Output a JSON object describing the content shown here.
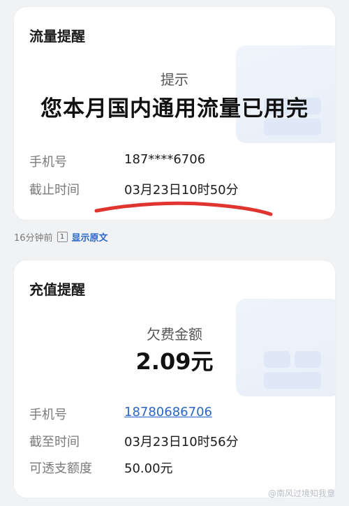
{
  "traffic_card": {
    "title": "流量提醒",
    "subtitle": "提示",
    "headline": "您本月国内通用流量已用完",
    "phone_label": "手机号",
    "phone_value": "187****6706",
    "deadline_label": "截止时间",
    "deadline_value": "03月23日10时50分"
  },
  "meta": {
    "time_ago": "16分钟前",
    "show_original": "显示原文"
  },
  "recharge_card": {
    "title": "充值提醒",
    "subtitle": "欠费金额",
    "amount": "2.09元",
    "phone_label": "手机号",
    "phone_value": "18780686706",
    "deadline_label": "截至时间",
    "deadline_value": "03月23日10时56分",
    "overdraft_label": "可透支额度",
    "overdraft_value": "50.00元"
  },
  "watermark": "@南风过境知我意",
  "colors": {
    "accent_link": "#2a66c5",
    "annotation_underline": "#e0342f"
  }
}
